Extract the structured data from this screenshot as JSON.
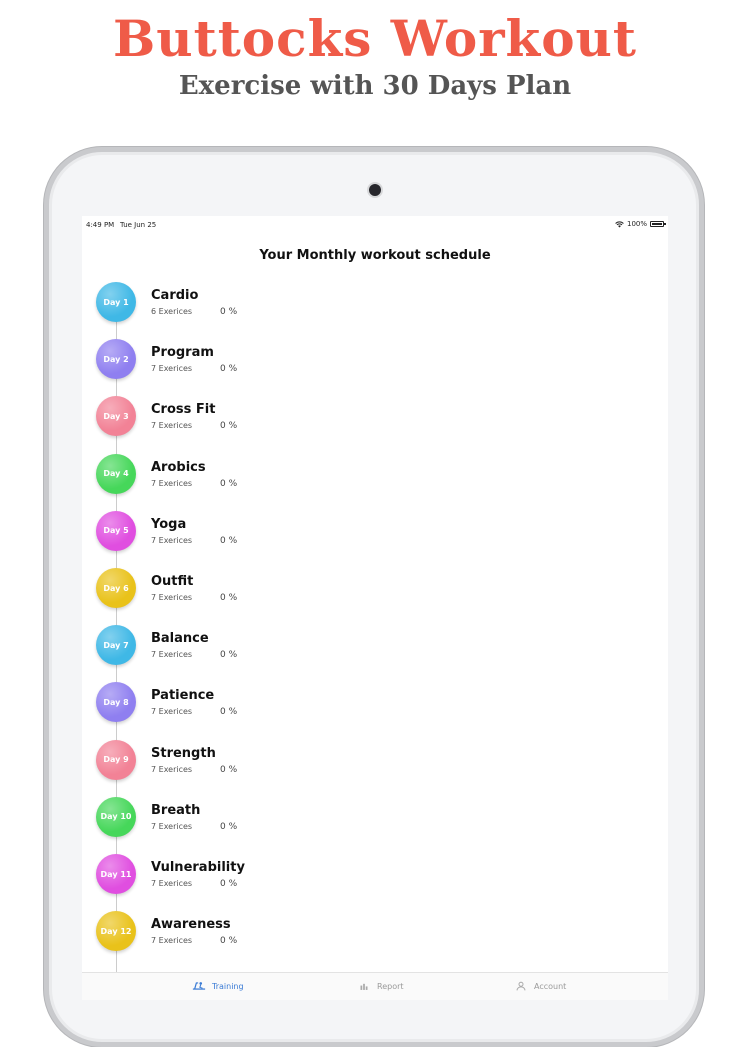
{
  "promo": {
    "title": "Buttocks Workout",
    "subtitle": "Exercise with 30 Days Plan"
  },
  "status_bar": {
    "time": "4:49 PM",
    "date": "Tue Jun 25",
    "battery": "100%"
  },
  "header": {
    "title": "Your Monthly workout schedule"
  },
  "days": [
    {
      "label": "Day 1",
      "name": "Cardio",
      "exercises": "6 Exerices",
      "percent": "0 %",
      "color": "#3fb8e6"
    },
    {
      "label": "Day 2",
      "name": "Program",
      "exercises": "7 Exerices",
      "percent": "0 %",
      "color": "#8f7ff0"
    },
    {
      "label": "Day 3",
      "name": "Cross Fit",
      "exercises": "7 Exerices",
      "percent": "0 %",
      "color": "#f28296"
    },
    {
      "label": "Day 4",
      "name": "Arobics",
      "exercises": "7 Exerices",
      "percent": "0 %",
      "color": "#46d75a"
    },
    {
      "label": "Day 5",
      "name": "Yoga",
      "exercises": "7 Exerices",
      "percent": "0 %",
      "color": "#e04ee0"
    },
    {
      "label": "Day 6",
      "name": "Outfit",
      "exercises": "7 Exerices",
      "percent": "0 %",
      "color": "#e9c21a"
    },
    {
      "label": "Day 7",
      "name": "Balance",
      "exercises": "7 Exerices",
      "percent": "0 %",
      "color": "#3fb8e6"
    },
    {
      "label": "Day 8",
      "name": "Patience",
      "exercises": "7 Exerices",
      "percent": "0 %",
      "color": "#8f7ff0"
    },
    {
      "label": "Day 9",
      "name": "Strength",
      "exercises": "7 Exerices",
      "percent": "0 %",
      "color": "#f28296"
    },
    {
      "label": "Day 10",
      "name": "Breath",
      "exercises": "7 Exerices",
      "percent": "0 %",
      "color": "#46d75a"
    },
    {
      "label": "Day 11",
      "name": "Vulnerability",
      "exercises": "7 Exerices",
      "percent": "0 %",
      "color": "#e04ee0"
    },
    {
      "label": "Day 12",
      "name": "Awareness",
      "exercises": "7 Exerices",
      "percent": "0 %",
      "color": "#e9c21a"
    }
  ],
  "tabs": [
    {
      "label": "Training",
      "icon": "treadmill-icon",
      "active": true
    },
    {
      "label": "Report",
      "icon": "report-icon",
      "active": false
    },
    {
      "label": "Account",
      "icon": "account-icon",
      "active": false
    }
  ]
}
